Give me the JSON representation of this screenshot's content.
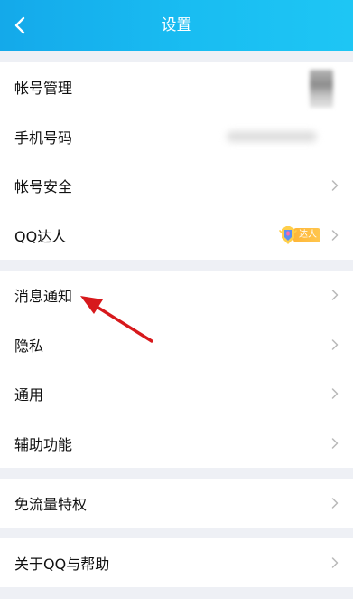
{
  "header": {
    "title": "设置"
  },
  "groups": [
    {
      "items": [
        {
          "label": "帐号管理",
          "extra": "blurred-avatar"
        },
        {
          "label": "手机号码",
          "extra": "blurred-phone"
        },
        {
          "label": "帐号安全",
          "extra": "chevron"
        },
        {
          "label": "QQ达人",
          "extra": "badge",
          "badge_text": "达人"
        }
      ]
    },
    {
      "items": [
        {
          "label": "消息通知"
        },
        {
          "label": "隐私"
        },
        {
          "label": "通用"
        },
        {
          "label": "辅助功能"
        }
      ]
    },
    {
      "items": [
        {
          "label": "免流量特权"
        }
      ]
    },
    {
      "items": [
        {
          "label": "关于QQ与帮助"
        }
      ]
    }
  ],
  "colors": {
    "header_start": "#14a9ea",
    "header_end": "#1ec6f4",
    "background": "#eef0f5",
    "annotation_arrow": "#d7191c"
  },
  "icons": {
    "back": "chevron-left-icon",
    "row_arrow": "chevron-right-icon",
    "qq_daren": "qq-daren-icon"
  }
}
